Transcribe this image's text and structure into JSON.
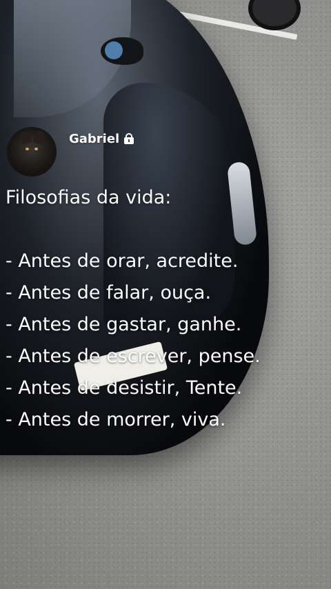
{
  "post": {
    "username": "Gabriel",
    "title": "Filosofias da vida:",
    "lines": [
      "- Antes de orar, acredite.",
      "- Antes de falar, ouça.",
      "- Antes de gastar, ganhe.",
      "- Antes de escrever, pense.",
      "- Antes de desistir, Tente.",
      "- Antes de morrer, viva."
    ]
  },
  "icons": {
    "lock": "lock-icon",
    "avatar": "dog-avatar"
  }
}
